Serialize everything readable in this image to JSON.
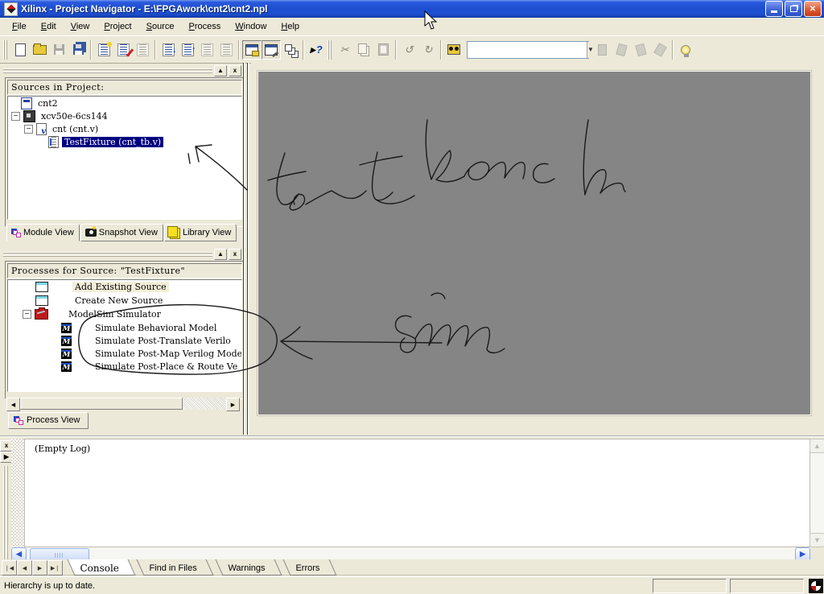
{
  "window": {
    "title": "Xilinx - Project Navigator - E:\\FPGAwork\\cnt2\\cnt2.npl"
  },
  "menu_bar": {
    "items": [
      "File",
      "Edit",
      "View",
      "Project",
      "Source",
      "Process",
      "Window",
      "Help"
    ]
  },
  "toolbar": {
    "search_combo_value": ""
  },
  "sources_panel": {
    "header": "Sources in Project:",
    "items": [
      {
        "label": "cnt2",
        "icon": "project-icon"
      },
      {
        "label": "xcv50e-6cs144",
        "icon": "device-icon"
      },
      {
        "label": "cnt (cnt.v)",
        "icon": "verilog-file-icon"
      },
      {
        "label": "TestFixture (cnt_tb.v)",
        "icon": "testbench-file-icon",
        "selected": true
      }
    ],
    "tabs": [
      {
        "label": "Module View",
        "active": true
      },
      {
        "label": "Snapshot View",
        "active": false
      },
      {
        "label": "Library View",
        "active": false
      }
    ]
  },
  "processes_panel": {
    "header": "Processes for Source:  \"TestFixture\"",
    "items": [
      {
        "label": "Add Existing Source",
        "icon": "source-window-icon",
        "highlighted": true
      },
      {
        "label": "Create New Source",
        "icon": "source-window-icon"
      },
      {
        "label": "ModelSim Simulator",
        "icon": "toolbox-icon"
      },
      {
        "label": "Simulate Behavioral Model",
        "icon": "modelsim-icon"
      },
      {
        "label": "Simulate Post-Translate Verilo",
        "icon": "modelsim-icon"
      },
      {
        "label": "Simulate Post-Map Verilog Mode",
        "icon": "modelsim-icon"
      },
      {
        "label": "Simulate Post-Place & Route Ve",
        "icon": "modelsim-icon"
      }
    ],
    "tab": "Process View"
  },
  "console_panel": {
    "log_text": "(Empty Log)",
    "tabs": [
      {
        "label": "Console",
        "active": true
      },
      {
        "label": "Find in Files",
        "active": false
      },
      {
        "label": "Warnings",
        "active": false
      },
      {
        "label": "Errors",
        "active": false
      }
    ]
  },
  "status_bar": {
    "message": "Hierarchy is up to date."
  },
  "annotations": {
    "labels": [
      "test bench",
      "sim"
    ]
  },
  "colors": {
    "titlebar_blue": "#1e4fd0",
    "selection_navy": "#000080",
    "canvas_gray": "#858585",
    "chrome_beige": "#ece9d8",
    "close_red": "#d9542e"
  }
}
